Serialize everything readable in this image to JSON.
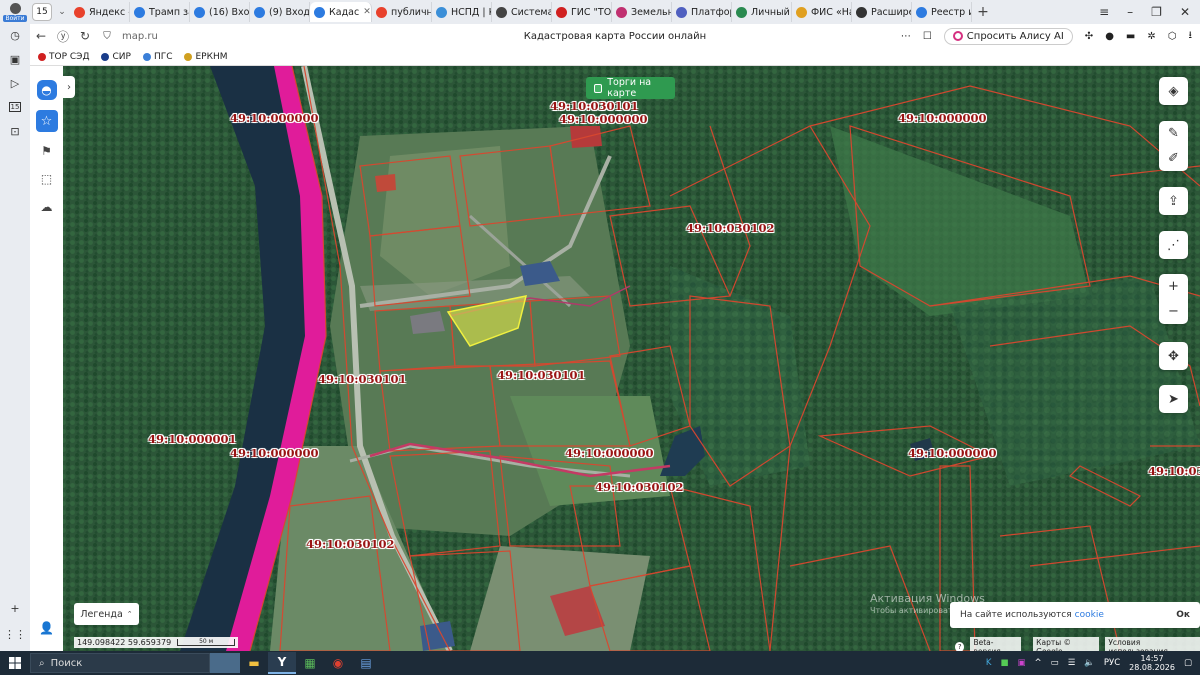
{
  "browser": {
    "profile_label": "Войти",
    "tab_count": "15",
    "tabs": [
      {
        "label": "Яндекс –",
        "color": "#e8412c"
      },
      {
        "label": "Трамп за",
        "color": "#2d7be0"
      },
      {
        "label": "(16) Вход",
        "color": "#2d7be0"
      },
      {
        "label": "(9) Входя",
        "color": "#2d7be0"
      },
      {
        "label": "Кадас",
        "color": "#2d7be0",
        "active": true
      },
      {
        "label": "публичн",
        "color": "#e8412c"
      },
      {
        "label": "НСПД | К",
        "color": "#3b8fd8"
      },
      {
        "label": "Система",
        "color": "#444444"
      },
      {
        "label": "ГИС \"ТО",
        "color": "#d02020"
      },
      {
        "label": "Земельн",
        "color": "#c03070"
      },
      {
        "label": "Платфор",
        "color": "#5060c0"
      },
      {
        "label": "Личный",
        "color": "#2a8a50"
      },
      {
        "label": "ФИС «На",
        "color": "#e0a020"
      },
      {
        "label": "Расшире",
        "color": "#333333"
      },
      {
        "label": "Реестр и",
        "color": "#2d7be0"
      }
    ],
    "url": "map.ru",
    "page_title": "Кадастровая карта России онлайн",
    "alice_label": "Спросить Алису AI",
    "side_badge": "15",
    "bookmarks": [
      {
        "label": "ТОР СЭД",
        "color": "#d02020"
      },
      {
        "label": "СИР",
        "color": "#1a3d8a"
      },
      {
        "label": "ПГС",
        "color": "#3b7fd8"
      },
      {
        "label": "ЕРКНМ",
        "color": "#d0a020"
      }
    ]
  },
  "map": {
    "torgi_label": "Торги на карте",
    "legend_label": "Легенда",
    "coordinates": "149.098422  59.659379",
    "scale_label": "50 м",
    "cadastral_labels": [
      "49:10:000000",
      "49:10:030101",
      "49:10:000000",
      "49:10:000000",
      "49:10:030102",
      "49:10:030101",
      "49:10:030101",
      "49:10:000001",
      "49:10:000000",
      "49:10:000000",
      "49:10:000000",
      "49:10:030102",
      "49:10:030102",
      "49:10:03"
    ],
    "watermark_title": "Активация Windows",
    "watermark_sub": "Чтобы активировать Windows, перейдите в раздел \"Параметры\".",
    "cookie_text": "На сайте используются",
    "cookie_link": "cookie",
    "cookie_ok": "Ок",
    "beta_label": "Beta-версия",
    "attribution": "Карты © Google",
    "terms": "Условия использования"
  },
  "taskbar": {
    "search_placeholder": "Поиск",
    "language": "РУС",
    "time": "14:57",
    "date": "28.08.2026"
  }
}
